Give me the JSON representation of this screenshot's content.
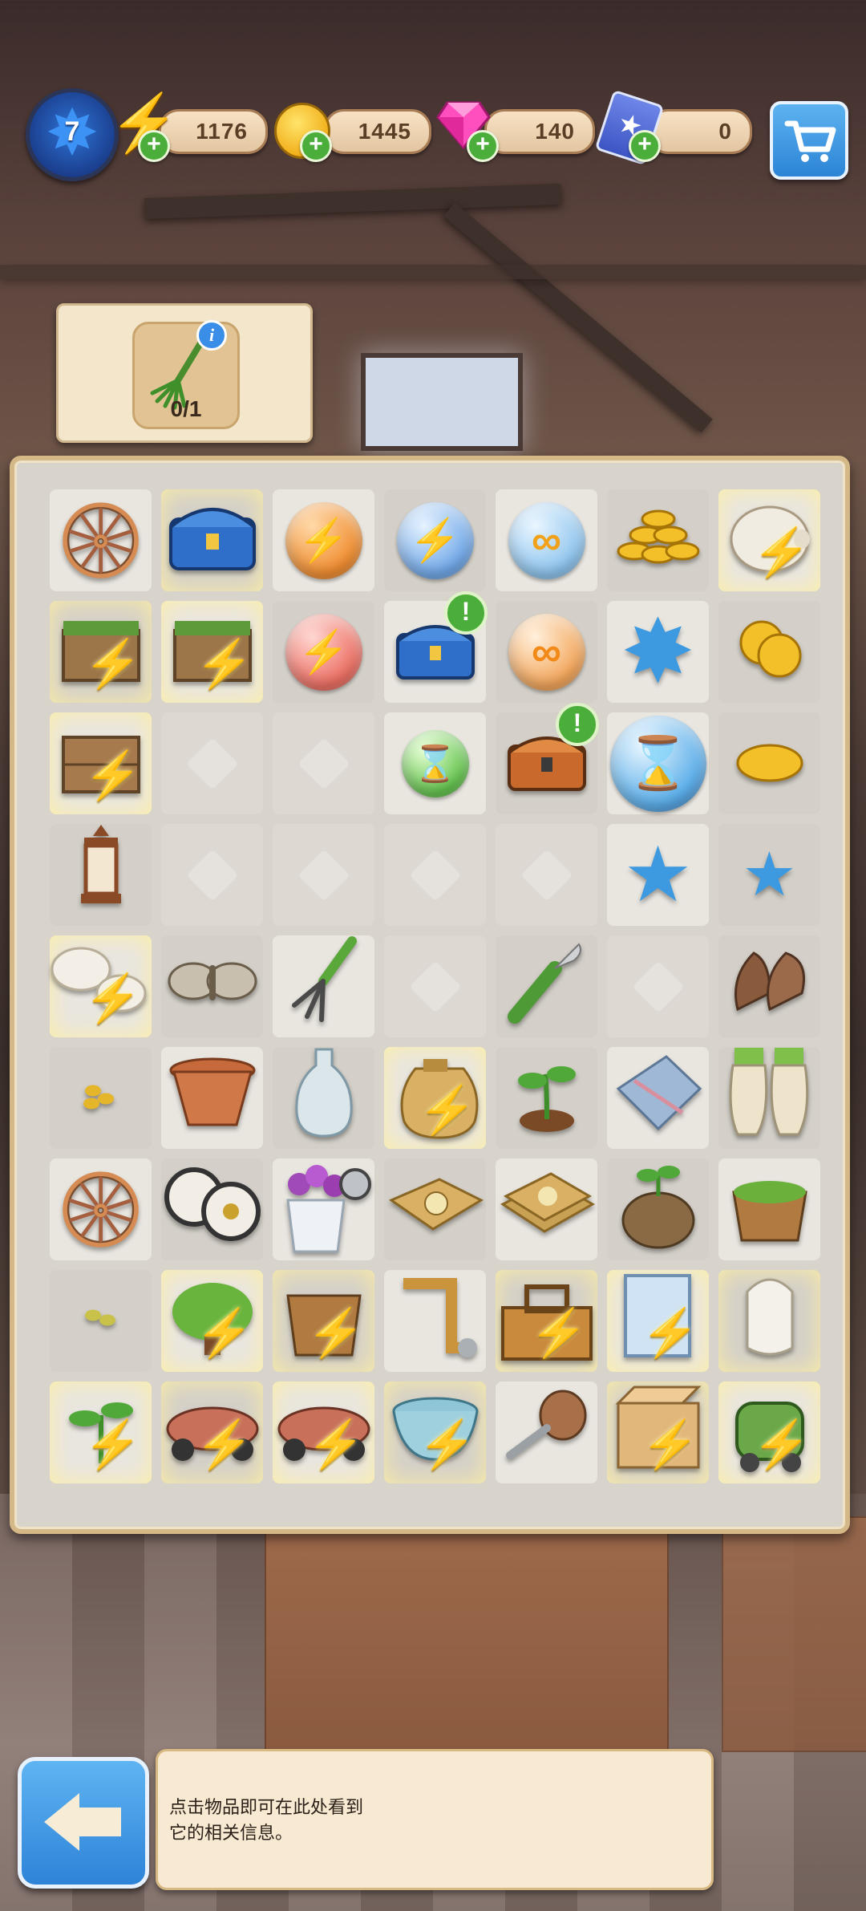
{
  "hud": {
    "level": "7",
    "energy": "1176",
    "coins": "1445",
    "gems": "140",
    "cards": "0",
    "icons": {
      "energy": "lightning-icon",
      "coins": "coin-icon",
      "gems": "gem-icon",
      "cards": "star-card-icon",
      "shop": "cart-icon"
    }
  },
  "goal": {
    "item_icon": "rake-icon",
    "progress": "0/1"
  },
  "board": {
    "rows": [
      [
        "tires",
        "chest-blue-glow",
        "energy-orb-orange",
        "energy-orb-blue",
        "infinity-orb-blue",
        "coin-pile",
        "piggy-bank-energy"
      ],
      [
        "energy-crate-grass",
        "energy-crate-grass",
        "energy-orb-red",
        "chest-blue-new",
        "infinity-orb-orange",
        "star-blue-big",
        "coins-two"
      ],
      [
        "energy-crate-wood",
        "empty",
        "empty",
        "hourglass-orb-green",
        "chest-orange-new",
        "hourglass-orb-blue",
        "coin-one"
      ],
      [
        "lantern",
        "empty",
        "empty",
        "empty",
        "empty",
        "star-blue",
        "star-blue-small"
      ],
      [
        "energy-moth-white",
        "moth",
        "garden-fork",
        "empty",
        "pruning-knife",
        "empty",
        "work-gloves"
      ],
      [
        "seeds-small",
        "clay-pot",
        "glass-vase",
        "energy-seed-bag",
        "seedling",
        "cloth",
        "garden-gloves"
      ],
      [
        "tires",
        "white-wheels",
        "flower-vase-timer",
        "seed-packet",
        "seed-packets",
        "sprout-pot",
        "herb-bucket"
      ],
      [
        "seeds-tiny",
        "energy-bush",
        "energy-bucket",
        "pipe-parts",
        "energy-toolbox",
        "energy-glass-panel",
        "lantern-white"
      ],
      [
        "energy-sprout",
        "energy-toy-car",
        "energy-toy-car",
        "energy-basin",
        "screw",
        "energy-box",
        "energy-cart"
      ]
    ]
  },
  "info_text": "点击物品即可在此处看到\n它的相关信息。",
  "back_icon": "back-arrow-icon"
}
